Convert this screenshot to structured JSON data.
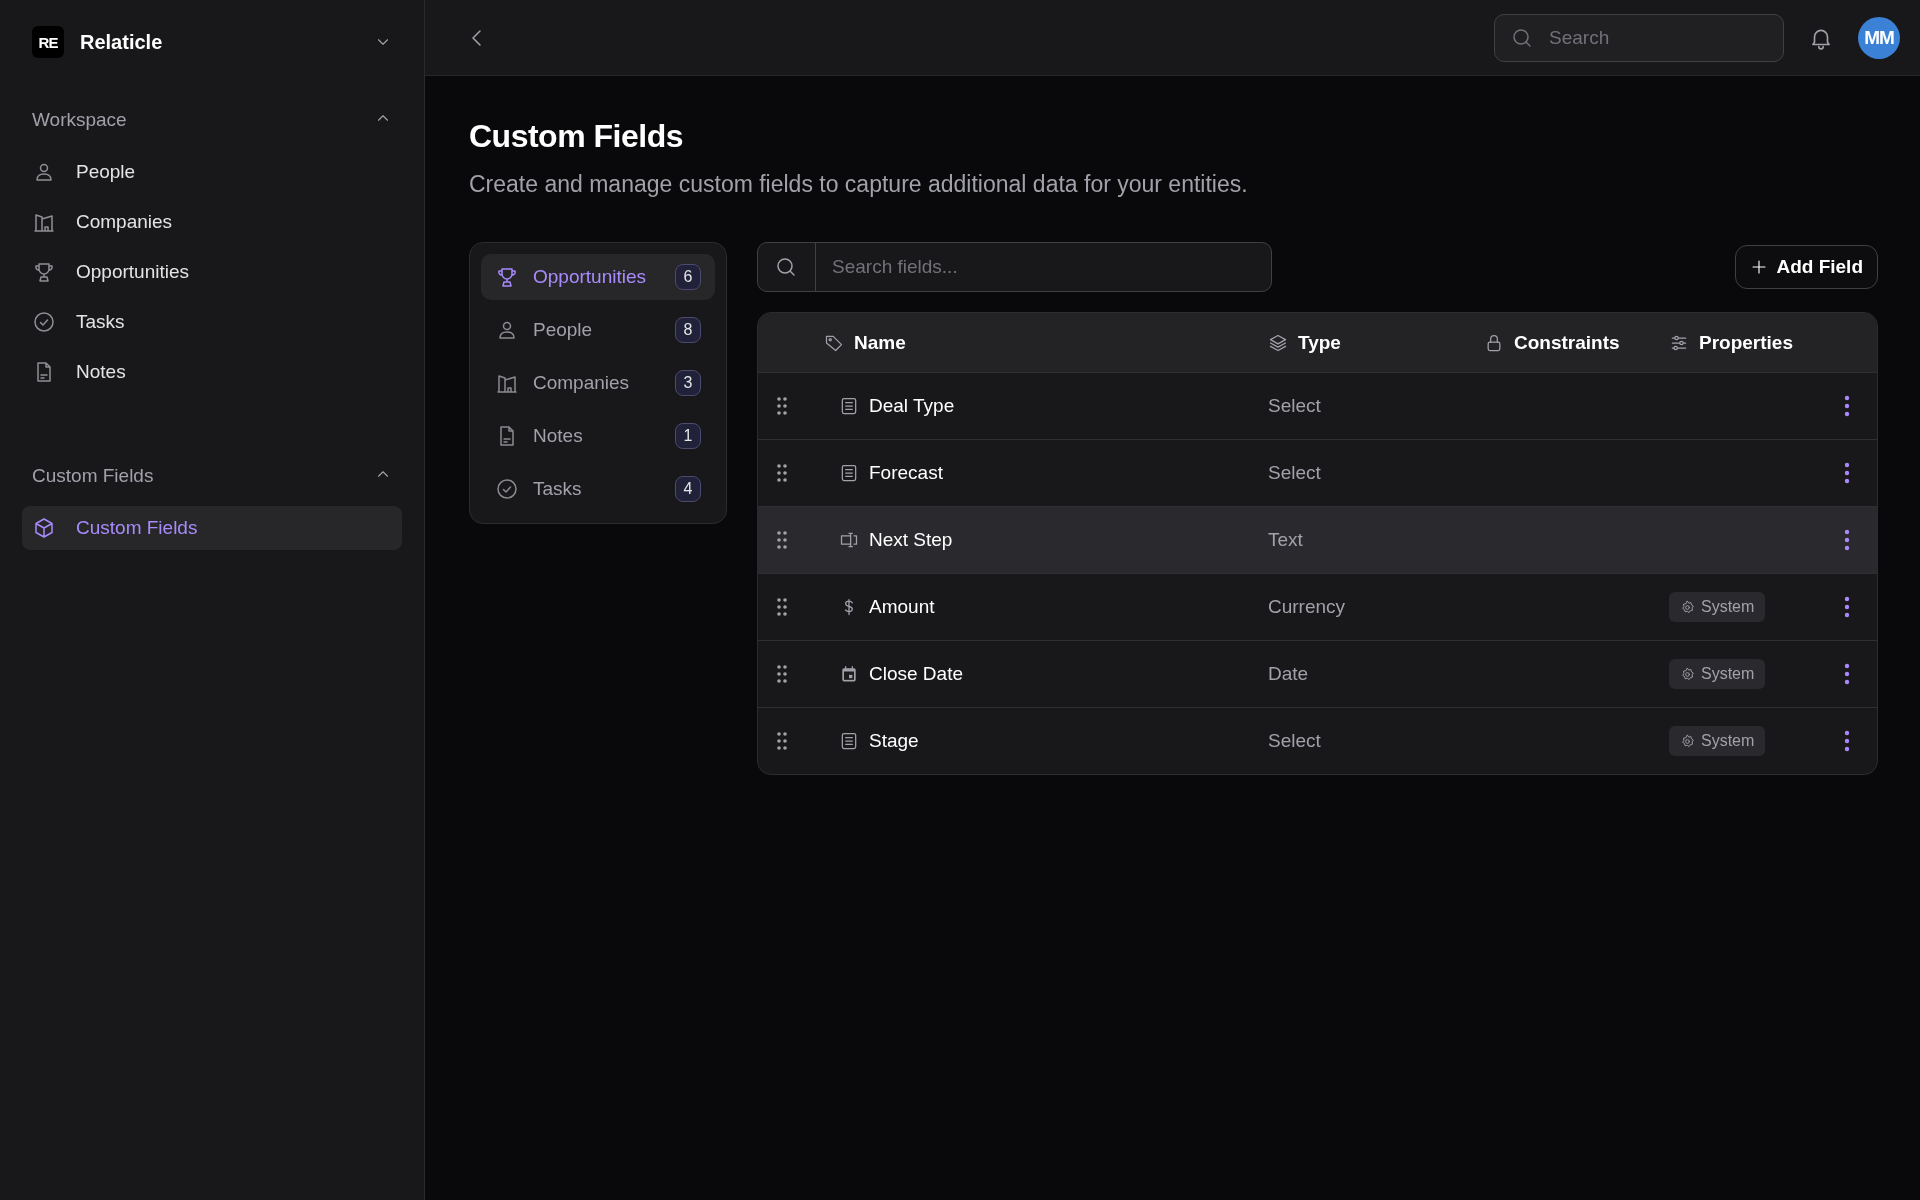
{
  "sidebar": {
    "brand": {
      "logo": "RE",
      "name": "Relaticle"
    },
    "sections": [
      {
        "title": "Workspace",
        "expanded": true,
        "items": [
          {
            "label": "People",
            "kind": "person",
            "selected": false
          },
          {
            "label": "Companies",
            "kind": "building",
            "selected": false
          },
          {
            "label": "Opportunities",
            "kind": "trophy",
            "selected": false
          },
          {
            "label": "Tasks",
            "kind": "check",
            "selected": false
          },
          {
            "label": "Notes",
            "kind": "note",
            "selected": false
          }
        ]
      },
      {
        "title": "Custom Fields",
        "expanded": true,
        "items": [
          {
            "label": "Custom Fields",
            "kind": "cube",
            "selected": true
          }
        ]
      }
    ]
  },
  "header": {
    "search": {
      "placeholder": "Search"
    },
    "avatar": "MM"
  },
  "page": {
    "title": "Custom Fields",
    "subtitle": "Create and manage custom fields to capture additional data for your entities."
  },
  "entities": [
    {
      "label": "Opportunities",
      "kind": "trophy",
      "count": "6",
      "selected": true
    },
    {
      "label": "People",
      "kind": "person",
      "count": "8",
      "selected": false
    },
    {
      "label": "Companies",
      "kind": "building",
      "count": "3",
      "selected": false
    },
    {
      "label": "Notes",
      "kind": "note",
      "count": "1",
      "selected": false
    },
    {
      "label": "Tasks",
      "kind": "check",
      "count": "4",
      "selected": false
    }
  ],
  "field_search": {
    "placeholder": "Search fields..."
  },
  "add_button": "Add Field",
  "table": {
    "columns": [
      {
        "label": "Name"
      },
      {
        "label": "Type"
      },
      {
        "label": "Constraints"
      },
      {
        "label": "Properties"
      }
    ],
    "rows": [
      {
        "name": "Deal Type",
        "kind": "select",
        "type": "Select",
        "selected": false
      },
      {
        "name": "Forecast",
        "kind": "select",
        "type": "Select",
        "selected": false
      },
      {
        "name": "Next Step",
        "kind": "text",
        "type": "Text",
        "selected": true
      },
      {
        "name": "Amount",
        "kind": "currency",
        "type": "Currency",
        "badge": "System",
        "selected": false
      },
      {
        "name": "Close Date",
        "kind": "date",
        "type": "Date",
        "badge": "System",
        "selected": false
      },
      {
        "name": "Stage",
        "kind": "select",
        "type": "Select",
        "badge": "System",
        "selected": false
      }
    ]
  }
}
